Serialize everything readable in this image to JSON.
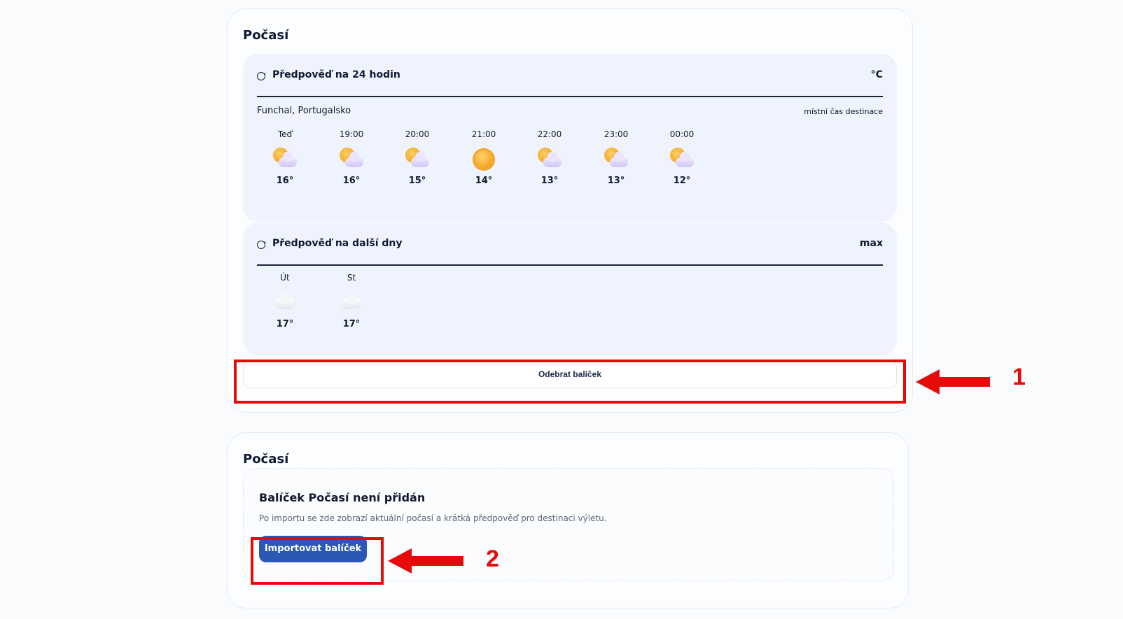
{
  "weather_card": {
    "title": "Počasí",
    "hourly": {
      "title": "Předpověď na 24 hodin",
      "unit": "°C",
      "location": "Funchal, Portugalsko",
      "time_note": "místní čas destinace",
      "slots": [
        {
          "time": "Teď",
          "icon": "partly-cloudy-icon",
          "temp": "16°"
        },
        {
          "time": "19:00",
          "icon": "partly-cloudy-icon",
          "temp": "16°"
        },
        {
          "time": "20:00",
          "icon": "partly-cloudy-icon",
          "temp": "15°"
        },
        {
          "time": "21:00",
          "icon": "sun-icon",
          "temp": "14°"
        },
        {
          "time": "22:00",
          "icon": "partly-cloudy-icon",
          "temp": "13°"
        },
        {
          "time": "23:00",
          "icon": "partly-cloudy-icon",
          "temp": "13°"
        },
        {
          "time": "00:00",
          "icon": "partly-cloudy-icon",
          "temp": "12°"
        }
      ]
    },
    "daily": {
      "title": "Předpověď na další dny",
      "unit": "max",
      "days": [
        {
          "day": "Út",
          "icon": "cloud-icon",
          "temp": "17°"
        },
        {
          "day": "St",
          "icon": "cloud-icon",
          "temp": "17°"
        }
      ]
    },
    "remove_button": "Odebrat balíček"
  },
  "empty_card": {
    "title": "Počasí",
    "heading": "Balíček Počasí není přidán",
    "description": "Po importu se zde zobrazí aktuální počasí a krátká předpověď pro destinaci výletu.",
    "import_button": "Importovat balíček"
  },
  "annotations": {
    "label_1": "1",
    "label_2": "2",
    "color": "#e50b0b"
  }
}
